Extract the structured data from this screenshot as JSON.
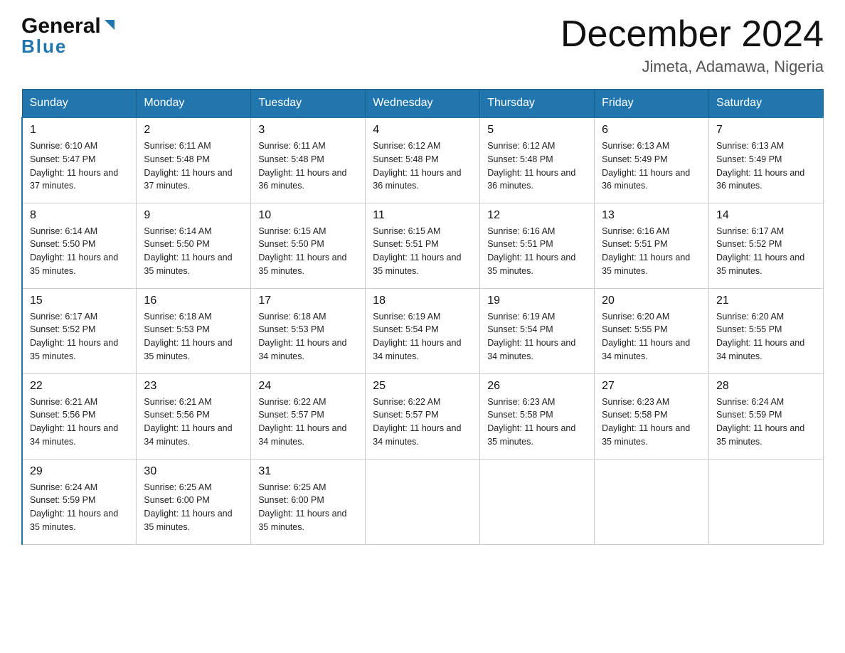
{
  "header": {
    "logo_general": "General",
    "logo_blue": "Blue",
    "title": "December 2024",
    "location": "Jimeta, Adamawa, Nigeria"
  },
  "days_of_week": [
    "Sunday",
    "Monday",
    "Tuesday",
    "Wednesday",
    "Thursday",
    "Friday",
    "Saturday"
  ],
  "weeks": [
    [
      {
        "day": "1",
        "sunrise": "6:10 AM",
        "sunset": "5:47 PM",
        "daylight": "11 hours and 37 minutes"
      },
      {
        "day": "2",
        "sunrise": "6:11 AM",
        "sunset": "5:48 PM",
        "daylight": "11 hours and 37 minutes"
      },
      {
        "day": "3",
        "sunrise": "6:11 AM",
        "sunset": "5:48 PM",
        "daylight": "11 hours and 36 minutes"
      },
      {
        "day": "4",
        "sunrise": "6:12 AM",
        "sunset": "5:48 PM",
        "daylight": "11 hours and 36 minutes"
      },
      {
        "day": "5",
        "sunrise": "6:12 AM",
        "sunset": "5:48 PM",
        "daylight": "11 hours and 36 minutes"
      },
      {
        "day": "6",
        "sunrise": "6:13 AM",
        "sunset": "5:49 PM",
        "daylight": "11 hours and 36 minutes"
      },
      {
        "day": "7",
        "sunrise": "6:13 AM",
        "sunset": "5:49 PM",
        "daylight": "11 hours and 36 minutes"
      }
    ],
    [
      {
        "day": "8",
        "sunrise": "6:14 AM",
        "sunset": "5:50 PM",
        "daylight": "11 hours and 35 minutes"
      },
      {
        "day": "9",
        "sunrise": "6:14 AM",
        "sunset": "5:50 PM",
        "daylight": "11 hours and 35 minutes"
      },
      {
        "day": "10",
        "sunrise": "6:15 AM",
        "sunset": "5:50 PM",
        "daylight": "11 hours and 35 minutes"
      },
      {
        "day": "11",
        "sunrise": "6:15 AM",
        "sunset": "5:51 PM",
        "daylight": "11 hours and 35 minutes"
      },
      {
        "day": "12",
        "sunrise": "6:16 AM",
        "sunset": "5:51 PM",
        "daylight": "11 hours and 35 minutes"
      },
      {
        "day": "13",
        "sunrise": "6:16 AM",
        "sunset": "5:51 PM",
        "daylight": "11 hours and 35 minutes"
      },
      {
        "day": "14",
        "sunrise": "6:17 AM",
        "sunset": "5:52 PM",
        "daylight": "11 hours and 35 minutes"
      }
    ],
    [
      {
        "day": "15",
        "sunrise": "6:17 AM",
        "sunset": "5:52 PM",
        "daylight": "11 hours and 35 minutes"
      },
      {
        "day": "16",
        "sunrise": "6:18 AM",
        "sunset": "5:53 PM",
        "daylight": "11 hours and 35 minutes"
      },
      {
        "day": "17",
        "sunrise": "6:18 AM",
        "sunset": "5:53 PM",
        "daylight": "11 hours and 34 minutes"
      },
      {
        "day": "18",
        "sunrise": "6:19 AM",
        "sunset": "5:54 PM",
        "daylight": "11 hours and 34 minutes"
      },
      {
        "day": "19",
        "sunrise": "6:19 AM",
        "sunset": "5:54 PM",
        "daylight": "11 hours and 34 minutes"
      },
      {
        "day": "20",
        "sunrise": "6:20 AM",
        "sunset": "5:55 PM",
        "daylight": "11 hours and 34 minutes"
      },
      {
        "day": "21",
        "sunrise": "6:20 AM",
        "sunset": "5:55 PM",
        "daylight": "11 hours and 34 minutes"
      }
    ],
    [
      {
        "day": "22",
        "sunrise": "6:21 AM",
        "sunset": "5:56 PM",
        "daylight": "11 hours and 34 minutes"
      },
      {
        "day": "23",
        "sunrise": "6:21 AM",
        "sunset": "5:56 PM",
        "daylight": "11 hours and 34 minutes"
      },
      {
        "day": "24",
        "sunrise": "6:22 AM",
        "sunset": "5:57 PM",
        "daylight": "11 hours and 34 minutes"
      },
      {
        "day": "25",
        "sunrise": "6:22 AM",
        "sunset": "5:57 PM",
        "daylight": "11 hours and 34 minutes"
      },
      {
        "day": "26",
        "sunrise": "6:23 AM",
        "sunset": "5:58 PM",
        "daylight": "11 hours and 35 minutes"
      },
      {
        "day": "27",
        "sunrise": "6:23 AM",
        "sunset": "5:58 PM",
        "daylight": "11 hours and 35 minutes"
      },
      {
        "day": "28",
        "sunrise": "6:24 AM",
        "sunset": "5:59 PM",
        "daylight": "11 hours and 35 minutes"
      }
    ],
    [
      {
        "day": "29",
        "sunrise": "6:24 AM",
        "sunset": "5:59 PM",
        "daylight": "11 hours and 35 minutes"
      },
      {
        "day": "30",
        "sunrise": "6:25 AM",
        "sunset": "6:00 PM",
        "daylight": "11 hours and 35 minutes"
      },
      {
        "day": "31",
        "sunrise": "6:25 AM",
        "sunset": "6:00 PM",
        "daylight": "11 hours and 35 minutes"
      },
      null,
      null,
      null,
      null
    ]
  ],
  "labels": {
    "sunrise": "Sunrise:",
    "sunset": "Sunset:",
    "daylight": "Daylight:"
  }
}
